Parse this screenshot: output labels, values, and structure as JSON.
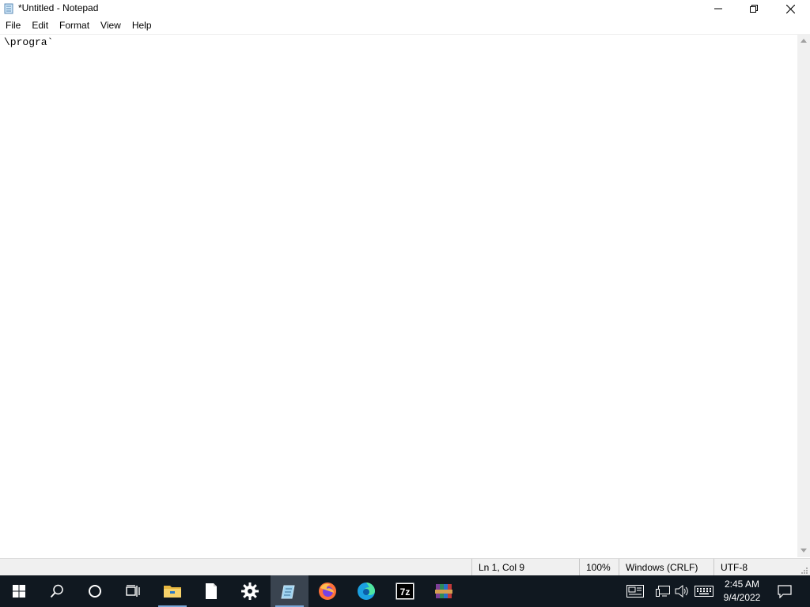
{
  "window": {
    "title": "*Untitled - Notepad",
    "controls": {
      "minimize": "minimize",
      "restore": "restore",
      "close": "close"
    }
  },
  "menu": {
    "items": [
      {
        "label": "File"
      },
      {
        "label": "Edit"
      },
      {
        "label": "Format"
      },
      {
        "label": "View"
      },
      {
        "label": "Help"
      }
    ]
  },
  "editor": {
    "content": "\\progra`"
  },
  "statusbar": {
    "position": "Ln 1, Col 9",
    "zoom": "100%",
    "line_ending": "Windows (CRLF)",
    "encoding": "UTF-8"
  },
  "taskbar": {
    "apps": [
      {
        "name": "start",
        "icon": "windows-logo-icon"
      },
      {
        "name": "search",
        "icon": "search-icon"
      },
      {
        "name": "cortana",
        "icon": "cortana-circle-icon"
      },
      {
        "name": "task-view",
        "icon": "task-view-icon"
      },
      {
        "name": "file-explorer",
        "icon": "folder-icon",
        "running": true
      },
      {
        "name": "blank-document",
        "icon": "document-icon"
      },
      {
        "name": "settings",
        "icon": "gear-icon"
      },
      {
        "name": "notepad",
        "icon": "notepad-icon",
        "active": true
      },
      {
        "name": "firefox",
        "icon": "firefox-icon"
      },
      {
        "name": "edge",
        "icon": "edge-icon"
      },
      {
        "name": "7-zip",
        "icon": "7zip-icon",
        "label": "7z"
      },
      {
        "name": "winrar",
        "icon": "winrar-icon"
      }
    ],
    "tray": [
      "news-icon",
      "network-icon",
      "volume-icon",
      "keyboard-icon"
    ],
    "clock": {
      "time": "2:45 AM",
      "date": "9/4/2022"
    }
  },
  "colors": {
    "taskbar": "#101820",
    "statusbar": "#f0f0f0",
    "accent": "#0078d7"
  }
}
